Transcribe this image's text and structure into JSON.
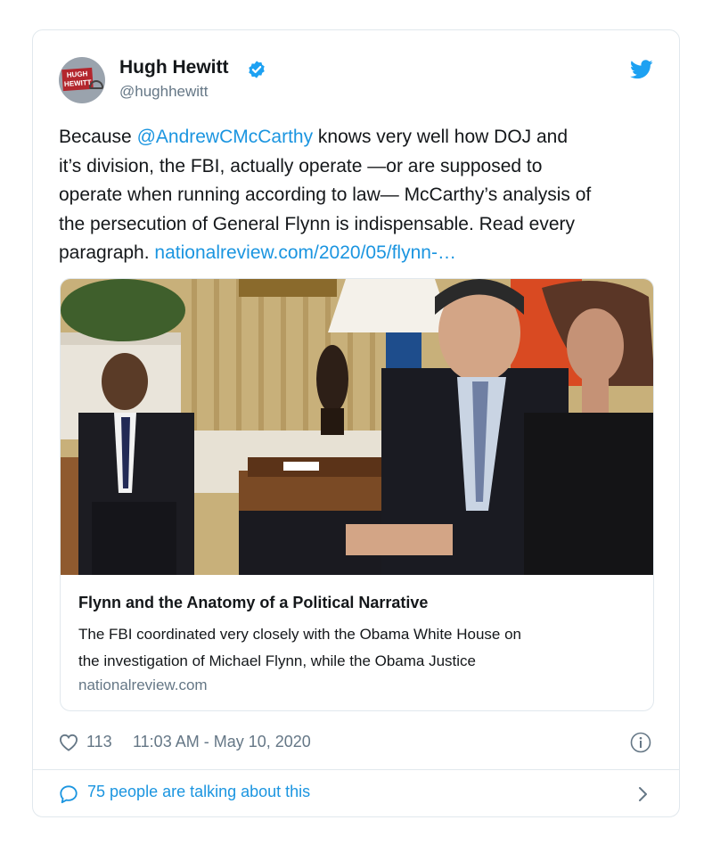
{
  "author": {
    "name": "Hugh Hewitt",
    "handle": "@hughhewitt",
    "avatar_sign_text": [
      "HUGH",
      "HEWITT"
    ]
  },
  "tweet": {
    "lines": [
      [
        "Because ",
        "@AndrewCMcCarthy",
        " knows very well how DOJ and"
      ],
      [
        "it’s division, the FBI, actually operate —or are supposed to"
      ],
      [
        "operate when running according to law— McCarthy’s analysis of"
      ],
      [
        "the persecution of General Flynn is indispensable. Read every"
      ],
      [
        "paragraph. ",
        "nationalreview.com/2020/05/flynn-…"
      ]
    ]
  },
  "card": {
    "title": "Flynn and the Anatomy of a Political Narrative",
    "description_lines": [
      "The FBI coordinated very closely with the Obama White House on",
      "the investigation of Michael Flynn, while the Obama Justice"
    ],
    "domain": "nationalreview.com"
  },
  "footer": {
    "likes": "113",
    "timestamp": "11:03 AM - May 10, 2020",
    "talking": "75 people are talking about this"
  },
  "colors": {
    "link": "#1b95e0",
    "secondary_text": "#657786",
    "border": "#e1e8ed",
    "verified": "#1da1f2"
  },
  "icons": [
    "verified-badge-icon",
    "twitter-bird-icon",
    "heart-icon",
    "info-icon",
    "speech-bubble-icon",
    "chevron-right-icon"
  ]
}
